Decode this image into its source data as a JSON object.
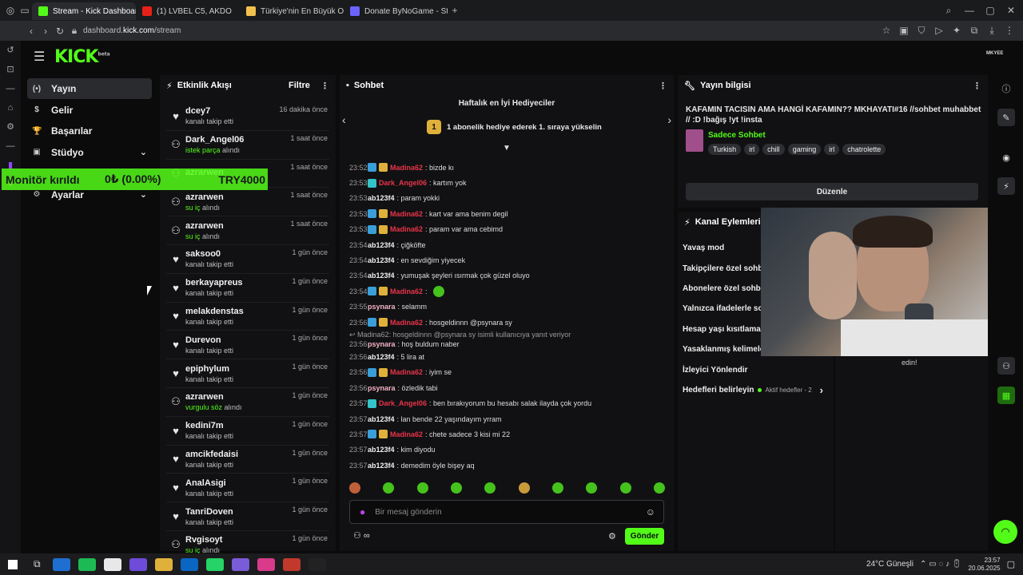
{
  "browser": {
    "tabs": [
      {
        "label": "Stream - Kick Dashboard",
        "color": "#53fc18",
        "active": true
      },
      {
        "label": "(1) LVBEL C5, AKDO",
        "color": "#e62117",
        "active": false
      },
      {
        "label": "Türkiye'nin En Büyük Oy",
        "color": "#f2c14e",
        "active": false
      },
      {
        "label": "Donate ByNoGame - Stre",
        "color": "#6c63ff",
        "active": false
      }
    ],
    "new_tab": "+",
    "url_prefix": "dashboard.",
    "url_domain": "kick.com",
    "url_path": "/stream"
  },
  "kick": {
    "logo": "KICK",
    "logo_sup": "beta",
    "avatar_text": "MKYEE"
  },
  "nav": {
    "items": [
      {
        "label": "Yayın",
        "icon": "(•)",
        "active": true
      },
      {
        "label": "Gelir",
        "icon": "$"
      },
      {
        "label": "Başarılar",
        "icon": "🏆"
      },
      {
        "label": "Stüdyo",
        "icon": "▣",
        "chevron": "⌄"
      },
      {
        "label": "Ayarlar",
        "icon": "⚙",
        "chevron": "⌄"
      }
    ]
  },
  "monitor": {
    "label": "Monitör kırıldı",
    "value": "0₺ (0.00%)",
    "target": "TRY4000"
  },
  "activity": {
    "title": "Etkinlik Akışı",
    "filter": "Filtre",
    "items": [
      {
        "name": "dcey7",
        "sub": "kanalı takip etti",
        "time": "16 dakika önce",
        "icon": "♥"
      },
      {
        "name": "Dark_Angel06",
        "sub_hl": "istek parça",
        "sub": " alındı",
        "time": "1 saat önce",
        "icon": "⚇"
      },
      {
        "name": "azrarwen",
        "sub": "",
        "time": "1 saat önce",
        "icon": "⚇"
      },
      {
        "name": "azrarwen",
        "sub_hl": "su iç",
        "sub": " alındı",
        "time": "1 saat önce",
        "icon": "⚇"
      },
      {
        "name": "azrarwen",
        "sub_hl": "su iç",
        "sub": " alındı",
        "time": "1 saat önce",
        "icon": "⚇"
      },
      {
        "name": "saksoo0",
        "sub": "kanalı takip etti",
        "time": "1 gün önce",
        "icon": "♥"
      },
      {
        "name": "berkayapreus",
        "sub": "kanalı takip etti",
        "time": "1 gün önce",
        "icon": "♥"
      },
      {
        "name": "melakdenstas",
        "sub": "kanalı takip etti",
        "time": "1 gün önce",
        "icon": "♥"
      },
      {
        "name": "Durevon",
        "sub": "kanalı takip etti",
        "time": "1 gün önce",
        "icon": "♥"
      },
      {
        "name": "epiphylum",
        "sub": "kanalı takip etti",
        "time": "1 gün önce",
        "icon": "♥"
      },
      {
        "name": "azrarwen",
        "sub_hl": "vurgulu söz",
        "sub": " alındı",
        "time": "1 gün önce",
        "icon": "⚇"
      },
      {
        "name": "kedini7m",
        "sub": "kanalı takip etti",
        "time": "1 gün önce",
        "icon": "♥"
      },
      {
        "name": "amcikfedaisi",
        "sub": "kanalı takip etti",
        "time": "1 gün önce",
        "icon": "♥"
      },
      {
        "name": "AnalAsigi",
        "sub": "kanalı takip etti",
        "time": "1 gün önce",
        "icon": "♥"
      },
      {
        "name": "TanriDoven",
        "sub": "kanalı takip etti",
        "time": "1 gün önce",
        "icon": "♥"
      },
      {
        "name": "Rvgisoyt",
        "sub_hl": "su iç",
        "sub": " alındı",
        "time": "1 gün önce",
        "icon": "⚇"
      }
    ]
  },
  "chat": {
    "title": "Sohbet",
    "top_gifters": "Haftalık en İyi Hediyeciler",
    "gift_rank": "1",
    "gift_prompt": "1 abonelik hediye ederek 1. sıraya yükselin",
    "messages": [
      {
        "time": "23:52",
        "user": "Madina62",
        "color": "#e8344a",
        "badges": [
          "blue",
          "gold"
        ],
        "text": ": bizde kı"
      },
      {
        "time": "23:53",
        "user": "Dark_Angel06",
        "color": "#e8344a",
        "badges": [
          "teal"
        ],
        "text": ": kartım yok"
      },
      {
        "time": "23:53",
        "user": "ab123f4",
        "color": "#f0f0f0",
        "badges": [],
        "text": ": param yokki"
      },
      {
        "time": "23:53",
        "user": "Madina62",
        "color": "#e8344a",
        "badges": [
          "blue",
          "gold"
        ],
        "text": ": kart var ama benim degil"
      },
      {
        "time": "23:53",
        "user": "Madina62",
        "color": "#e8344a",
        "badges": [
          "blue",
          "gold"
        ],
        "text": ": param var ama cebimd"
      },
      {
        "time": "23:54",
        "user": "ab123f4",
        "color": "#f0f0f0",
        "badges": [],
        "text": ": çiğköfte"
      },
      {
        "time": "23:54",
        "user": "ab123f4",
        "color": "#f0f0f0",
        "badges": [],
        "text": ": en sevdiğim yiyecek"
      },
      {
        "time": "23:54",
        "user": "ab123f4",
        "color": "#f0f0f0",
        "badges": [],
        "text": ": yumuşak şeyleri ısırmak çok güzel oluyo"
      },
      {
        "time": "23:54",
        "user": "Madina62",
        "color": "#e8344a",
        "badges": [
          "blue",
          "gold"
        ],
        "text": ":",
        "emote": true
      },
      {
        "time": "23:55",
        "user": "psynara",
        "color": "#f3b3c4",
        "badges": [],
        "text": ": selamm"
      },
      {
        "time": "23:56",
        "user": "Madina62",
        "color": "#e8344a",
        "badges": [
          "blue",
          "gold"
        ],
        "text": ": hosgeldinnn @psynara sy"
      },
      {
        "reply": "Madina62: hosgeldinnn @psynara sy isimli kullanıcıya yanıt veriyor",
        "time": "23:56",
        "user": "psynara",
        "color": "#f3b3c4",
        "badges": [],
        "text": ": hoş buldum naber"
      },
      {
        "time": "23:56",
        "user": "ab123f4",
        "color": "#f0f0f0",
        "badges": [],
        "text": ": 5 lira at"
      },
      {
        "time": "23:56",
        "user": "Madina62",
        "color": "#e8344a",
        "badges": [
          "blue",
          "gold"
        ],
        "text": ": iyim se"
      },
      {
        "time": "23:56",
        "user": "psynara",
        "color": "#f3b3c4",
        "badges": [],
        "text": ": özledik tabi"
      },
      {
        "time": "23:57",
        "user": "Dark_Angel06",
        "color": "#e8344a",
        "badges": [
          "teal"
        ],
        "text": ": ben bırakıyorum bu hesabı salak ilayda çok yordu"
      },
      {
        "time": "23:57",
        "user": "ab123f4",
        "color": "#f0f0f0",
        "badges": [],
        "text": ": lan bende 22 yaşındayım yrram"
      },
      {
        "time": "23:57",
        "user": "Madina62",
        "color": "#e8344a",
        "badges": [
          "blue",
          "gold"
        ],
        "text": ": chete sadece 3 kisi mi 22"
      },
      {
        "time": "23:57",
        "user": "ab123f4",
        "color": "#f0f0f0",
        "badges": [],
        "text": ": kim diyodu"
      },
      {
        "time": "23:57",
        "user": "ab123f4",
        "color": "#f0f0f0",
        "badges": [],
        "text": ": demedim öyle bişey aq"
      }
    ],
    "input_placeholder": "Bir mesaj gönderin",
    "send_label": "Gönder",
    "viewers_icon": "∞"
  },
  "stream_info": {
    "title": "Yayın bilgisi",
    "stream_title": "KAFAMIN TACISIN AMA HANGİ KAFAMIN?? MKHAYATI#16 //sohbet muhabbet // :D !bağış !yt !insta",
    "category": "Sadece Sohbet",
    "tags": [
      "Turkish",
      "irl",
      "chill",
      "gaming",
      "irl",
      "chatrolette"
    ],
    "edit_label": "Düzenle"
  },
  "channel_actions": {
    "title": "Kanal Eylemleri",
    "items": [
      {
        "label": "Yavaş mod"
      },
      {
        "label": "Takipçilere özel sohbet"
      },
      {
        "label": "Abonelere özel sohbet"
      },
      {
        "label": "Yalnızca ifadelerle sohbet"
      },
      {
        "label": "Hesap yaşı kısıtlaması"
      },
      {
        "label": "Yasaklanmış kelimeler",
        "chevron": "›"
      },
      {
        "label": "İzleyici Yönlendir"
      },
      {
        "label": "Hedefleri belirleyin",
        "extra": "Aktif hedefler - 2",
        "chevron": "›"
      }
    ]
  },
  "under_cam_text": "edin!",
  "taskbar": {
    "weather": "24°C  Güneşli",
    "time": "23:57",
    "date": "20.06.2025"
  }
}
